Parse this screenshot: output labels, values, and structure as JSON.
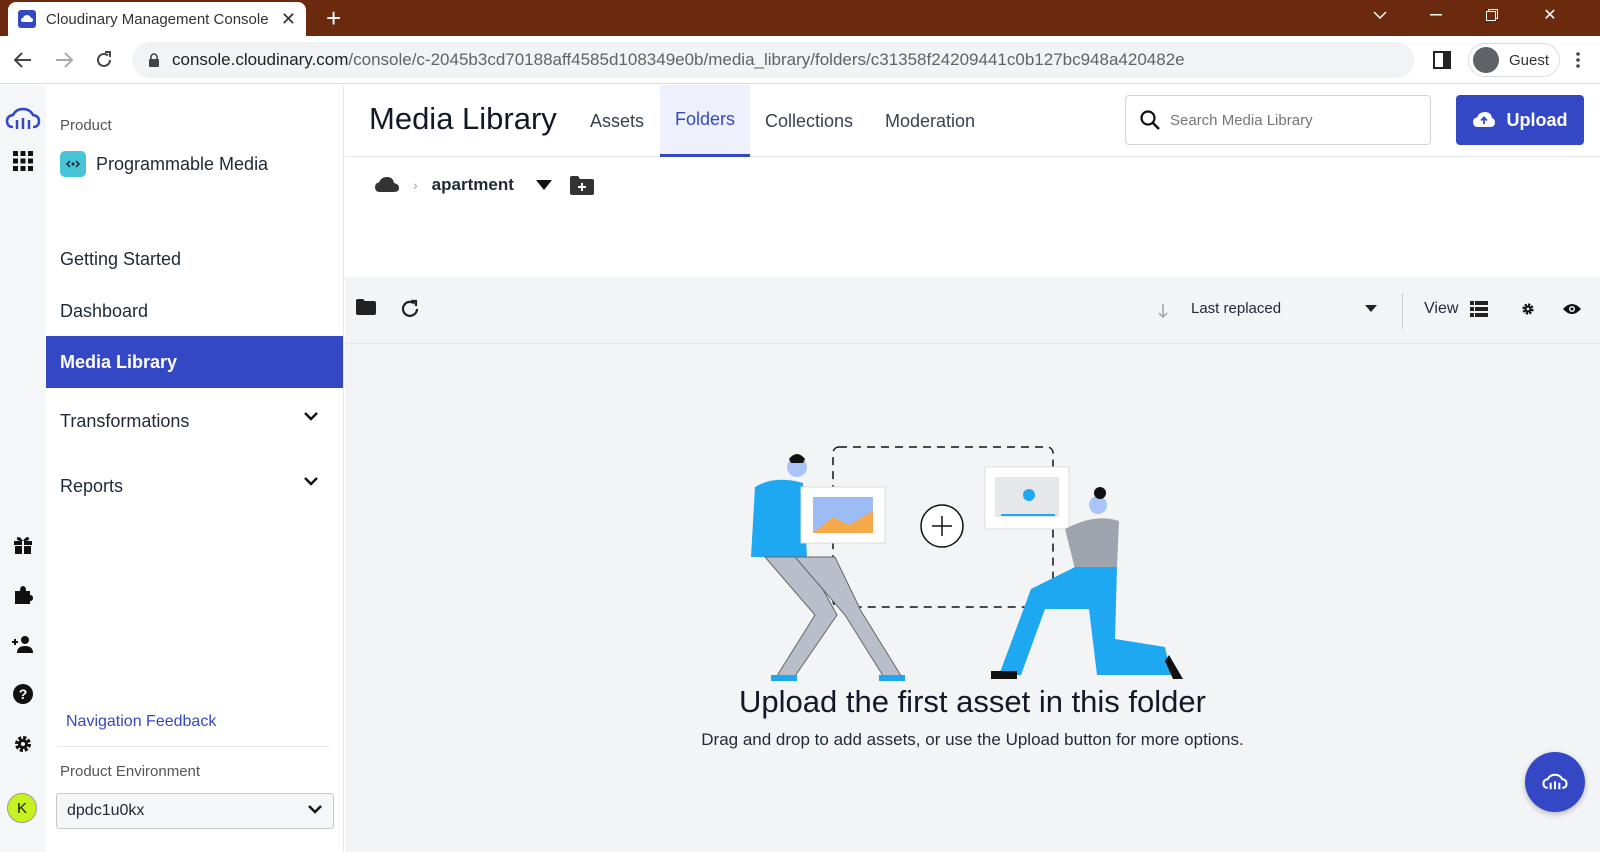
{
  "browser": {
    "tab_title": "Cloudinary Management Console",
    "url_host": "console.cloudinary.com",
    "url_path": "/console/c-2045b3cd70188aff4585d108349e0b/media_library/folders/c31358f24209441c0b127bc948a420482e",
    "profile_label": "Guest"
  },
  "colors": {
    "brand": "#3448c5",
    "titlebar": "#6b2a0e",
    "avatar": "#c6f31d"
  },
  "rail": {
    "avatar_initial": "K",
    "icons": [
      "cloudinary-logo-icon",
      "apps-grid-icon",
      "gift-icon",
      "puzzle-icon",
      "add-user-icon",
      "help-icon",
      "gear-icon"
    ]
  },
  "sidebar": {
    "product_label": "Product",
    "product_name": "Programmable Media",
    "items": [
      {
        "label": "Getting Started"
      },
      {
        "label": "Dashboard"
      },
      {
        "label": "Media Library",
        "active": true
      },
      {
        "label": "Transformations",
        "expandable": true
      },
      {
        "label": "Reports",
        "expandable": true
      }
    ],
    "feedback_link": "Navigation Feedback",
    "env_label": "Product Environment",
    "env_value": "dpdc1u0kx"
  },
  "header": {
    "title": "Media Library",
    "tabs": [
      {
        "label": "Assets"
      },
      {
        "label": "Folders",
        "active": true
      },
      {
        "label": "Collections"
      },
      {
        "label": "Moderation"
      }
    ],
    "search_placeholder": "Search Media Library",
    "upload_label": "Upload"
  },
  "breadcrumb": {
    "current": "apartment"
  },
  "toolbar": {
    "sort_label": "Last replaced",
    "view_label": "View"
  },
  "empty_state": {
    "title": "Upload the first asset in this folder",
    "subtitle": "Drag and drop to add assets, or use the Upload button for more options."
  }
}
